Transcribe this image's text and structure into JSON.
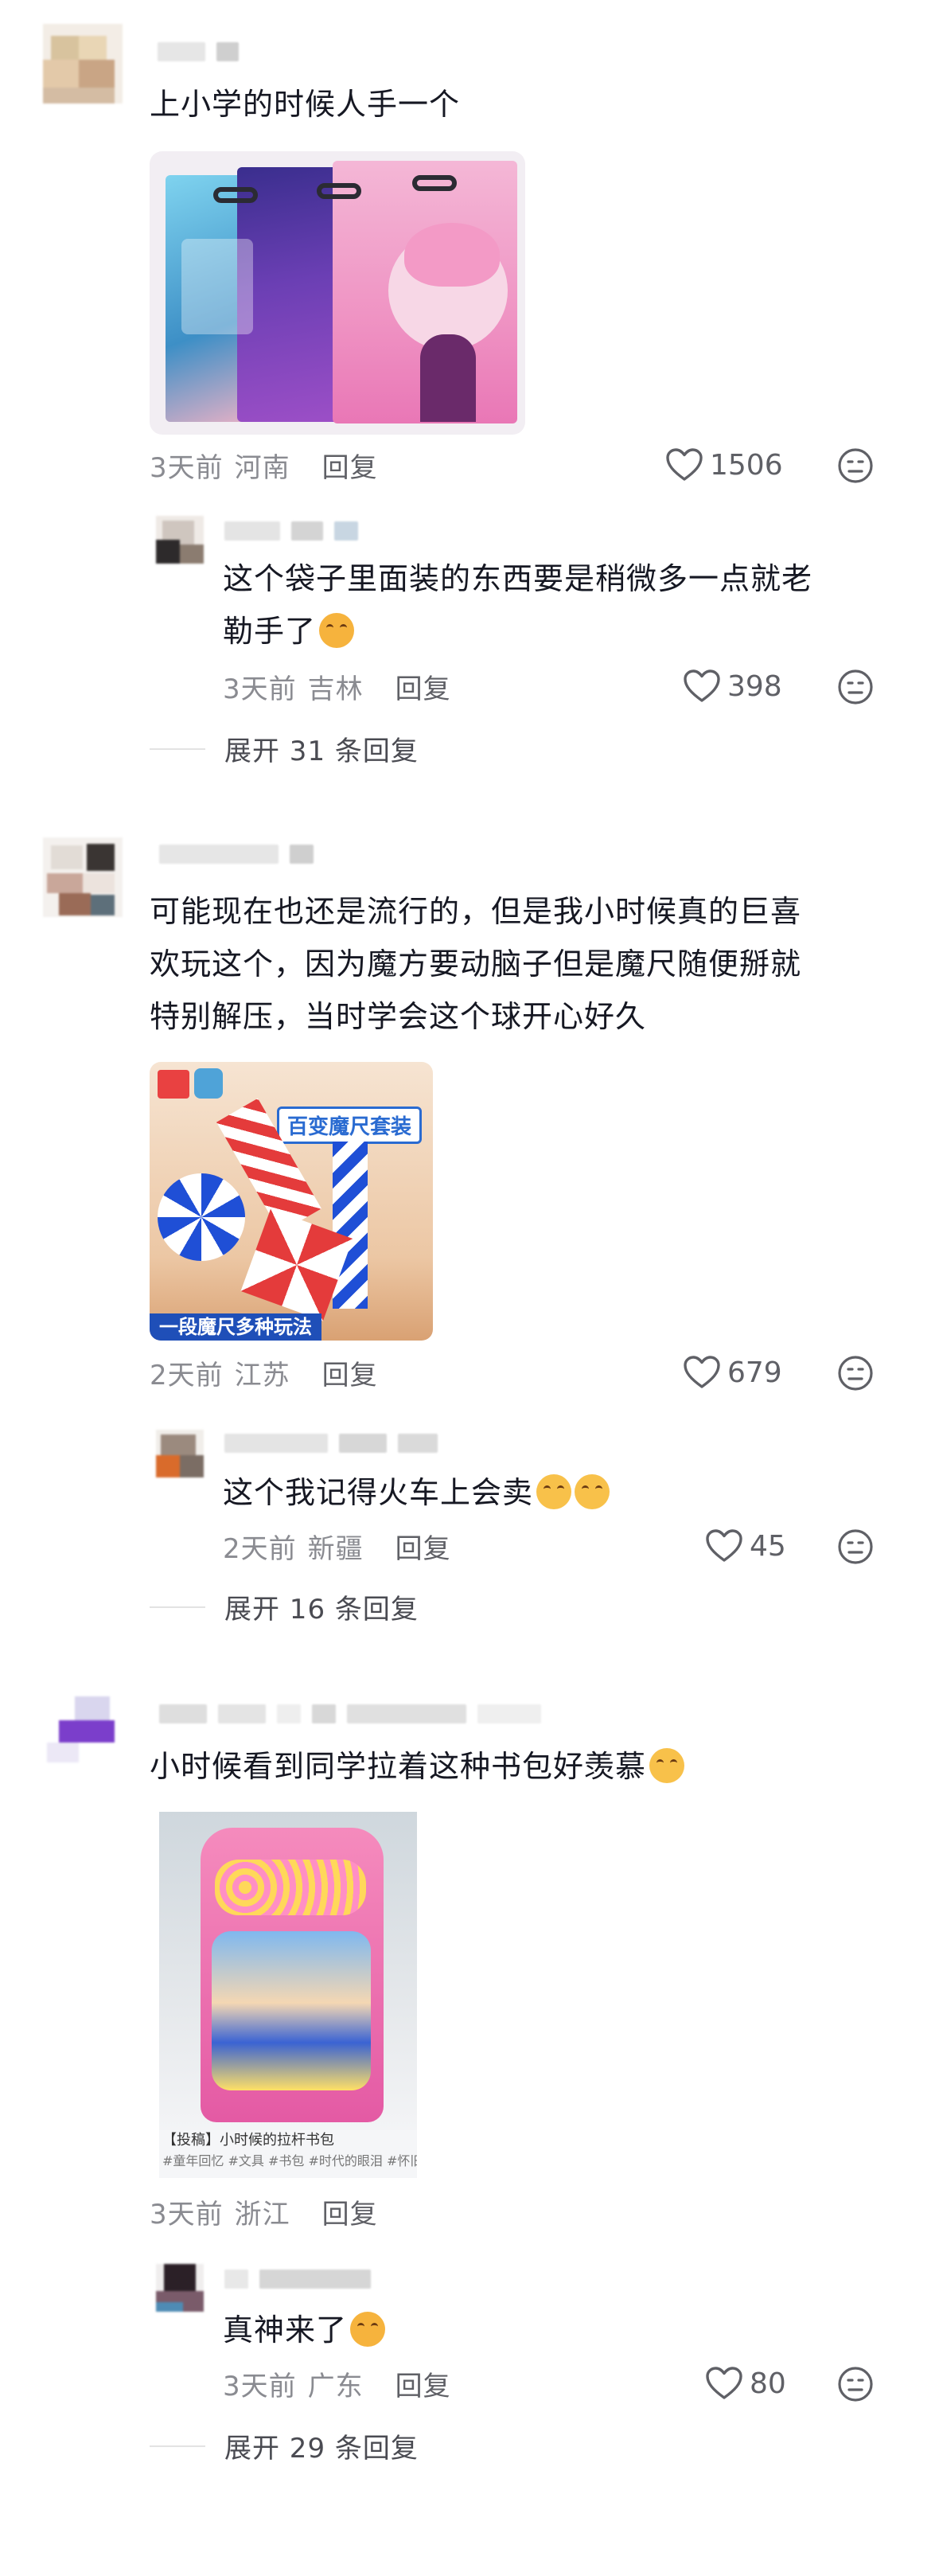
{
  "comments": [
    {
      "text": "上小学的时候人手一个",
      "time": "3天前",
      "location": "河南",
      "reply_label": "回复",
      "likes": "1506",
      "reply": {
        "text_line1": "这个袋子里面装的东西要是稍微多一点就老",
        "text_line2": "勒手了",
        "time": "3天前",
        "location": "吉林",
        "reply_label": "回复",
        "likes": "398"
      },
      "expand_label": "展开 31 条回复"
    },
    {
      "text_line1": "可能现在也还是流行的，但是我小时候真的巨喜",
      "text_line2": "欢玩这个，因为魔方要动脑子但是魔尺随便掰就",
      "text_line3": "特别解压，当时学会这个球开心好久",
      "image_text_top": "百变魔尺套装",
      "image_text_bottom": "一段魔尺多种玩法",
      "time": "2天前",
      "location": "江苏",
      "reply_label": "回复",
      "likes": "679",
      "reply": {
        "text": "这个我记得火车上会卖",
        "time": "2天前",
        "location": "新疆",
        "reply_label": "回复",
        "likes": "45"
      },
      "expand_label": "展开 16 条回复"
    },
    {
      "text": "小时候看到同学拉着这种书包好羡慕",
      "image_caption_1": "【投稿】小时候的拉杆书包",
      "image_caption_2": "#童年回忆 #文具 #书包 #时代的眼泪 #怀旧",
      "time": "3天前",
      "location": "浙江",
      "reply_label": "回复",
      "reply": {
        "text": "真神来了",
        "time": "3天前",
        "location": "广东",
        "reply_label": "回复",
        "likes": "80"
      },
      "expand_label": "展开 29 条回复"
    }
  ],
  "colors": {
    "text": "#161823",
    "meta": "#8a8b91",
    "divider": "#e3e3e3"
  },
  "icons": {
    "like": "heart-outline-icon",
    "dislike": "meh-face-icon",
    "emoji_laugh_cry": "laugh-cry-emoji-icon",
    "emoji_cry": "crying-emoji-icon"
  }
}
